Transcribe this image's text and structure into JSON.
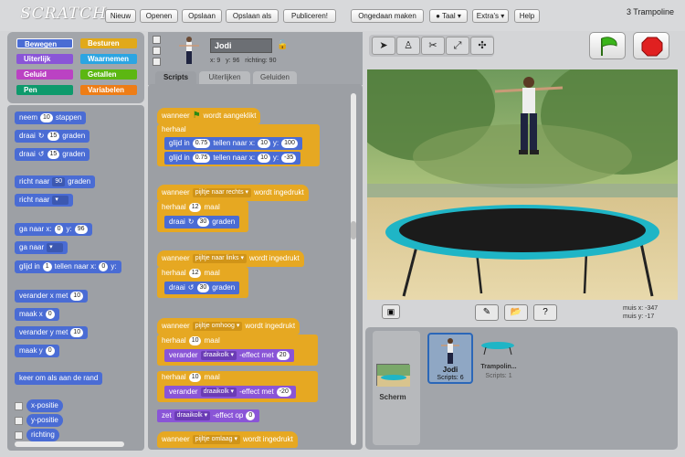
{
  "app": {
    "logo": "SCRATCH",
    "project_title": "3 Trampoline"
  },
  "menu": {
    "nieuw": "Nieuw",
    "openen": "Openen",
    "opslaan": "Opslaan",
    "opslaan_als": "Opslaan als",
    "publiceren": "Publiceren!",
    "ongedaan": "Ongedaan maken",
    "taal": "Taal",
    "extras": "Extra's",
    "help": "Help"
  },
  "categories": {
    "bewegen": "Bewegen",
    "uiterlijk": "Uiterlijk",
    "geluid": "Geluid",
    "pen": "Pen",
    "besturen": "Besturen",
    "waarnemen": "Waarnemen",
    "getallen": "Getallen",
    "variabelen": "Variabelen"
  },
  "palette": {
    "move_pre": "neem",
    "move_val": "10",
    "move_post": "stappen",
    "turn_label": "draai",
    "turn_val": "15",
    "turn_post": "graden",
    "turn2_val": "15",
    "point_pre": "richt naar",
    "point_val": "90",
    "point_post": "graden",
    "point_to": "richt naar",
    "goto_pre": "ga naar x:",
    "goto_x": "0",
    "goto_ylbl": "y:",
    "goto_y": "96",
    "goto2": "ga naar",
    "glide_pre": "glijd in",
    "glide_val": "1",
    "glide_mid": "tellen naar x:",
    "glide_x": "0",
    "glide_ylbl": "y:",
    "changex_pre": "verander x met",
    "changex_val": "10",
    "setx_pre": "maak x",
    "setx_val": "0",
    "changey_pre": "verander y met",
    "changey_val": "10",
    "sety_pre": "maak y",
    "sety_val": "0",
    "bounce": "keer om als aan de rand",
    "xpos": "x-positie",
    "ypos": "y-positie",
    "dir": "richting"
  },
  "sprite": {
    "name": "Jodi",
    "x_label": "x:",
    "x": "9",
    "y_label": "y:",
    "y": "96",
    "dir_label": "richting:",
    "dir": "90"
  },
  "tabs": {
    "scripts": "Scripts",
    "costumes": "Uiterlijken",
    "sounds": "Geluiden"
  },
  "scripts": {
    "s1_hat_pre": "wanneer",
    "s1_hat_post": "wordt aangeklikt",
    "herhaal": "herhaal",
    "glide": "glijd in",
    "glide_t": "0.75",
    "glide_mid": "tellen naar x:",
    "glide_x": "10",
    "y_label": "y:",
    "glide1_y": "100",
    "glide2_y": "-35",
    "wanneer": "wanneer",
    "wordt_ingedrukt": "wordt ingedrukt",
    "key_right": "pijltje naar rechts",
    "key_left": "pijltje naar links",
    "key_up": "pijltje omhoog",
    "key_down": "pijltje omlaag",
    "herhaal_n": "12",
    "maal": "maal",
    "draai": "draai",
    "turn_val": "30",
    "graden": "graden",
    "herhaal_10": "10",
    "verander": "verander",
    "effect": "draaikolk",
    "effect_met": "-effect met",
    "effect_val1": "20",
    "effect_val2": "-20",
    "zet": "zet",
    "effect_op": "-effect op",
    "effect_zero": "0"
  },
  "stage": {
    "mouse_x_label": "muis x:",
    "mouse_x": "-347",
    "mouse_y_label": "muis y:",
    "mouse_y": "-17"
  },
  "sprites": {
    "stage_label": "Scherm",
    "jodi_name": "Jodi",
    "jodi_scripts": "Scripts: 6",
    "tramp_name": "Trampolin...",
    "tramp_scripts": "Scripts: 1"
  }
}
